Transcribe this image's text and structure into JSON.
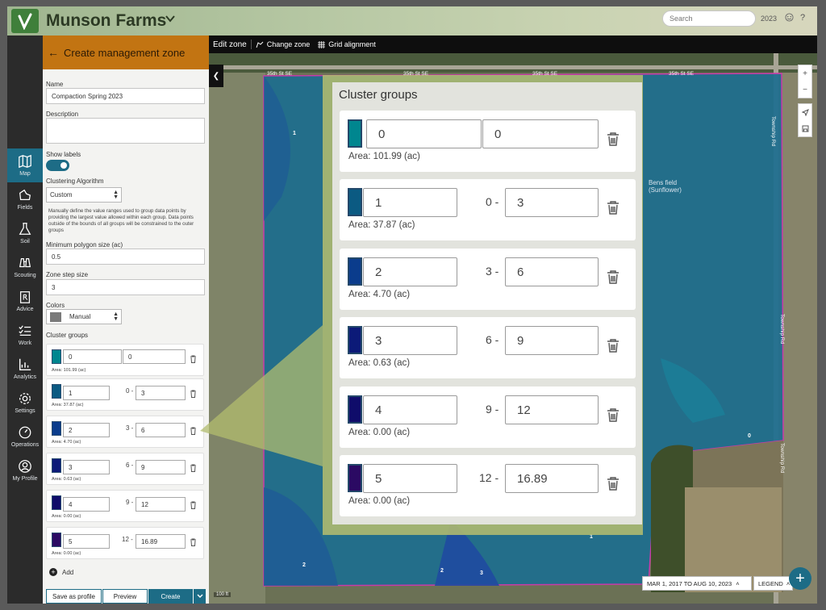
{
  "header": {
    "farm_name": "Munson Farms",
    "search_placeholder": "Search",
    "year": "2023",
    "help_label": "?"
  },
  "nav": [
    {
      "label": "Map",
      "icon": "map-icon"
    },
    {
      "label": "Fields",
      "icon": "fields-icon"
    },
    {
      "label": "Soil",
      "icon": "soil-flask-icon"
    },
    {
      "label": "Scouting",
      "icon": "binoculars-icon"
    },
    {
      "label": "Advice",
      "icon": "rx-clipboard-icon"
    },
    {
      "label": "Work",
      "icon": "checklist-icon"
    },
    {
      "label": "Analytics",
      "icon": "chart-icon"
    },
    {
      "label": "Settings",
      "icon": "gear-icon"
    },
    {
      "label": "Operations",
      "icon": "gauge-icon"
    },
    {
      "label": "My Profile",
      "icon": "user-icon"
    }
  ],
  "panel": {
    "title": "Create management zone",
    "name_label": "Name",
    "name_value": "Compaction Spring 2023",
    "description_label": "Description",
    "show_labels_label": "Show labels",
    "clustering_label": "Clustering Algorithm",
    "clustering_value": "Custom",
    "help_text": "Manually define the value ranges used to group data points by providing the largest value allowed within each group. Data points outside of the bounds of all groups will be constrained to the outer groups",
    "min_polygon_label": "Minimum polygon size (ac)",
    "min_polygon_value": "0.5",
    "zone_step_label": "Zone step size",
    "zone_step_value": "3",
    "colors_label": "Colors",
    "colors_value": "Manual",
    "cluster_groups_label": "Cluster groups",
    "add_label": "Add",
    "save_profile_label": "Save as profile",
    "preview_label": "Preview",
    "create_label": "Create"
  },
  "cluster_groups": [
    {
      "value": "0",
      "lower": "",
      "upper": "0",
      "area": "Area: 101.99 (ac)",
      "color": "#00868f"
    },
    {
      "value": "1",
      "lower": "0 -",
      "upper": "3",
      "area": "Area: 37.87 (ac)",
      "color": "#0b5a82"
    },
    {
      "value": "2",
      "lower": "3 -",
      "upper": "6",
      "area": "Area: 4.70 (ac)",
      "color": "#0a3c8c"
    },
    {
      "value": "3",
      "lower": "6 -",
      "upper": "9",
      "area": "Area: 0.63 (ac)",
      "color": "#0c1a78"
    },
    {
      "value": "4",
      "lower": "9 -",
      "upper": "12",
      "area": "Area: 0.00 (ac)",
      "color": "#0f0c6a"
    },
    {
      "value": "5",
      "lower": "12 -",
      "upper": "16.89",
      "area": "Area: 0.00 (ac)",
      "color": "#2b0a63"
    }
  ],
  "toolbar": {
    "edit_zone": "Edit zone",
    "change_zone": "Change zone",
    "grid_alignment": "Grid alignment"
  },
  "map": {
    "roads": [
      "35th St SE",
      "35th St SE",
      "35th St SE",
      "35th St SE",
      "Township Rd",
      "Township Rd",
      "Township Rd"
    ],
    "field_label": "Bens field\n(Sunflower)",
    "zone_labels": [
      "1",
      "0",
      "2",
      "2",
      "3",
      "1"
    ],
    "date_range": "MAR 1, 2017 TO AUG 10, 2023",
    "legend_label": "LEGEND",
    "scale_label": "100 ft",
    "zoom_in": "+",
    "zoom_out": "−"
  },
  "callout": {
    "title": "Cluster groups"
  }
}
